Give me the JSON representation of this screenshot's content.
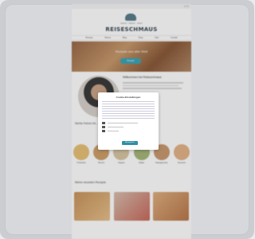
{
  "site": {
    "topbar_icons": "✉ ☰",
    "logo_sub": "kochen · backen · reisen",
    "logo_text": "REISESCHMAUS",
    "nav": [
      "Rezepte",
      "Reisen",
      "Blog",
      "Shop",
      "Über",
      "Kontakt"
    ],
    "hero_title": "Rezepte aus aller Welt",
    "hero_button": "Rezepte",
    "welcome_title": "Willkommen bei Reiseschmaus",
    "categories_title": "Nichts Feines für...",
    "categories": [
      "Frühstück",
      "Brunch",
      "Suppen",
      "Salate",
      "Hauptgerichte",
      "Desserts"
    ],
    "recipes_title": "Meine neuesten Rezepte"
  },
  "cookie_dialog": {
    "title": "Cookie-Einstellungen",
    "accept_label": "Akzeptieren"
  },
  "colors": {
    "accent": "#3aa6b9",
    "logo": "#3a4a55"
  }
}
